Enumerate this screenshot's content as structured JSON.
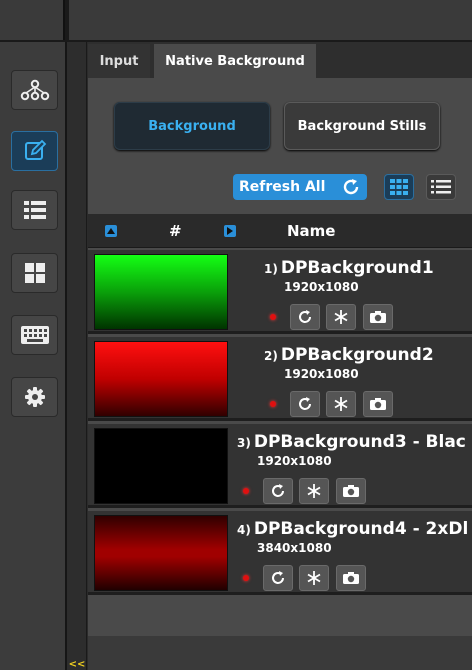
{
  "tabs": [
    {
      "label": "Input",
      "active": false
    },
    {
      "label": "Native Background",
      "active": true
    }
  ],
  "sidebar": {
    "items": [
      {
        "icon": "network-icon",
        "active": false
      },
      {
        "icon": "edit-icon",
        "active": true
      },
      {
        "icon": "list-icon",
        "active": false
      },
      {
        "icon": "grid-icon",
        "active": false
      },
      {
        "icon": "keyboard-icon",
        "active": false
      },
      {
        "icon": "gear-icon",
        "active": false
      }
    ],
    "collapse_label": "<<"
  },
  "mode": {
    "background_label": "Background",
    "stills_label": "Background Stills"
  },
  "toolbar": {
    "refresh_label": "Refresh All",
    "view": "grid"
  },
  "table": {
    "col_num": "#",
    "col_name": "Name"
  },
  "rows": [
    {
      "num": "1)",
      "name": "DPBackground1",
      "res": "1920x1080",
      "thumb_color": "#14ff14"
    },
    {
      "num": "2)",
      "name": "DPBackground2",
      "res": "1920x1080",
      "thumb_color": "#ff1010"
    },
    {
      "num": "3)",
      "name": "DPBackground3 - Blac",
      "res": "1920x1080",
      "thumb_color": "#000000"
    },
    {
      "num": "4)",
      "name": "DPBackground4 - 2xDl",
      "res": "3840x1080",
      "thumb_color": "#a00000"
    }
  ],
  "colors": {
    "accent": "#2a8fd8",
    "status_dot": "#e01010"
  }
}
